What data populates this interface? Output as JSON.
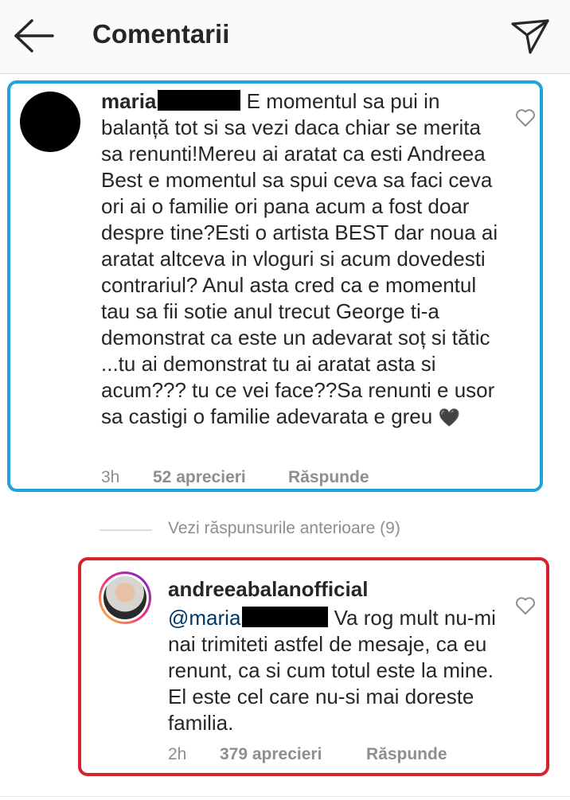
{
  "header": {
    "title": "Comentarii",
    "back_icon": "arrow-left-icon",
    "send_icon": "paper-plane-icon"
  },
  "comment": {
    "username": "maria",
    "text": "E momentul sa pui in balanță tot si sa vezi daca chiar se merita sa renunti!Mereu ai aratat ca esti Andreea Best e momentul sa spui ceva sa faci ceva ori ai o familie ori pana acum a fost doar despre tine?Esti o artista BEST dar noua ai aratat altceva in vloguri si acum dovedesti contrariul? Anul asta cred ca e momentul tau sa fii sotie anul trecut George ti-a demonstrat ca este un adevarat soț si tătic ...tu ai demonstrat tu ai aratat asta si acum??? tu ce vei face??Sa renunti e usor sa castigi o familie adevarata e greu",
    "emoji": "🖤",
    "time": "3h",
    "likes": "52 aprecieri",
    "reply_label": "Răspunde"
  },
  "replies_toggle": {
    "label": "Vezi răspunsurile anterioare (9)"
  },
  "reply": {
    "username": "andreeabalanofficial",
    "mention": "@maria",
    "text": "Va rog mult nu-mi nai trimiteti astfel de mesaje, ca eu renunt, ca si cum totul este la mine. El este cel care nu-si mai doreste familia.",
    "time": "2h",
    "likes": "379 aprecieri",
    "reply_label": "Răspunde"
  },
  "colors": {
    "highlight_blue": "#1fa3db",
    "highlight_red": "#d8222b",
    "text_primary": "#262626",
    "text_secondary": "#8e8e8e",
    "mention": "#00376b"
  }
}
